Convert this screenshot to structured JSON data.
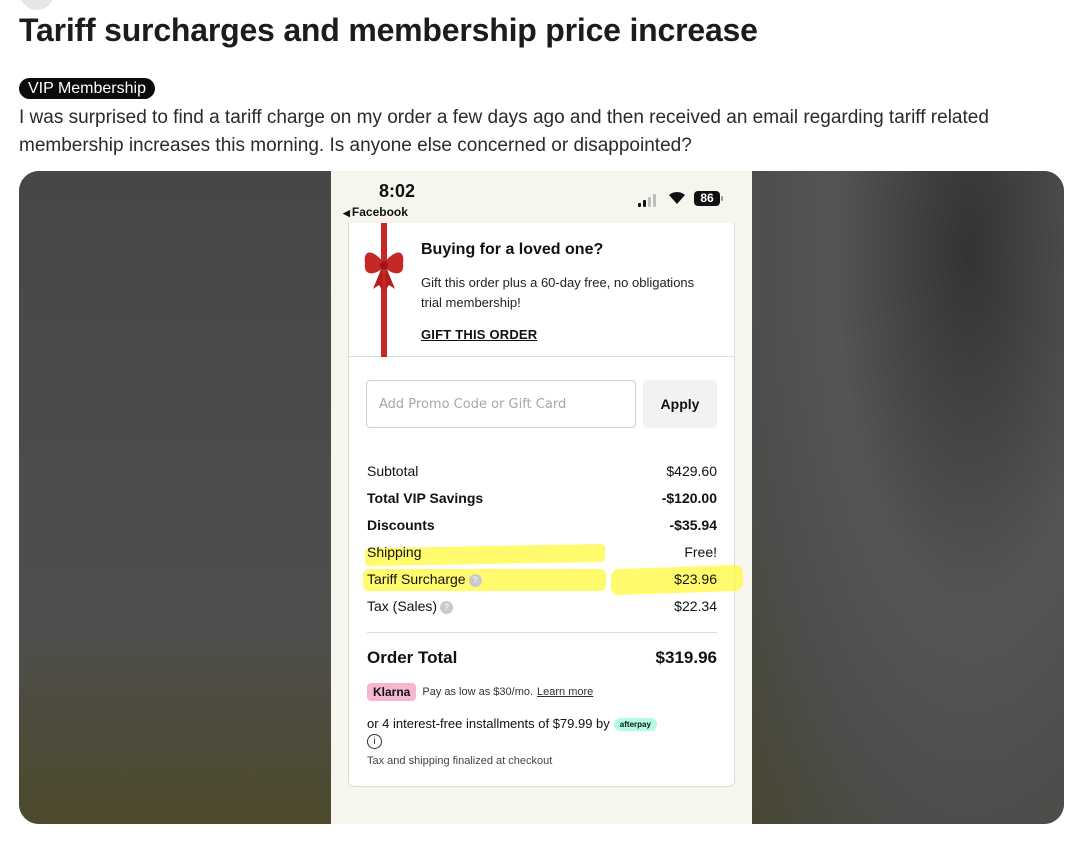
{
  "post": {
    "title": "Tariff surcharges and membership price increase",
    "flair": "VIP Membership",
    "body": "I was surprised to find a tariff charge on my order a few days ago and then received an email regarding tariff related membership increases this morning. Is anyone else concerned or disappointed?"
  },
  "phone": {
    "time": "8:02",
    "back_app": "Facebook",
    "battery": "86",
    "icons": [
      "back-arrow-icon",
      "signal-icon",
      "wifi-icon",
      "battery-icon",
      "ribbon-bow-icon",
      "help-icon",
      "info-icon"
    ]
  },
  "gift": {
    "title": "Buying for a loved one?",
    "description": "Gift this order plus a 60-day free, no obligations trial membership!",
    "link": "GIFT THIS ORDER"
  },
  "promo": {
    "placeholder": "Add Promo Code or Gift Card",
    "apply": "Apply"
  },
  "summary": {
    "subtotal_label": "Subtotal",
    "subtotal_value": "$429.60",
    "vip_label": "Total VIP Savings",
    "vip_value": "-$120.00",
    "discounts_label": "Discounts",
    "discounts_value": "-$35.94",
    "shipping_label": "Shipping",
    "shipping_value": "Free!",
    "tariff_label": "Tariff Surcharge",
    "tariff_value": "$23.96",
    "tax_label": "Tax (Sales)",
    "tax_value": "$22.34",
    "total_label": "Order Total",
    "total_value": "$319.96"
  },
  "payments": {
    "klarna_badge": "Klarna",
    "klarna_text": "Pay as low as $30/mo.",
    "klarna_link": "Learn more",
    "afterpay_text": "or 4 interest-free installments of $79.99 by",
    "afterpay_badge": "afterpay",
    "fine_print": "Tax and shipping finalized at checkout"
  },
  "colors": {
    "highlight": "#fffa3c",
    "ribbon": "#c62828",
    "klarna": "#f5b6cf",
    "afterpay": "#b2fce4"
  }
}
